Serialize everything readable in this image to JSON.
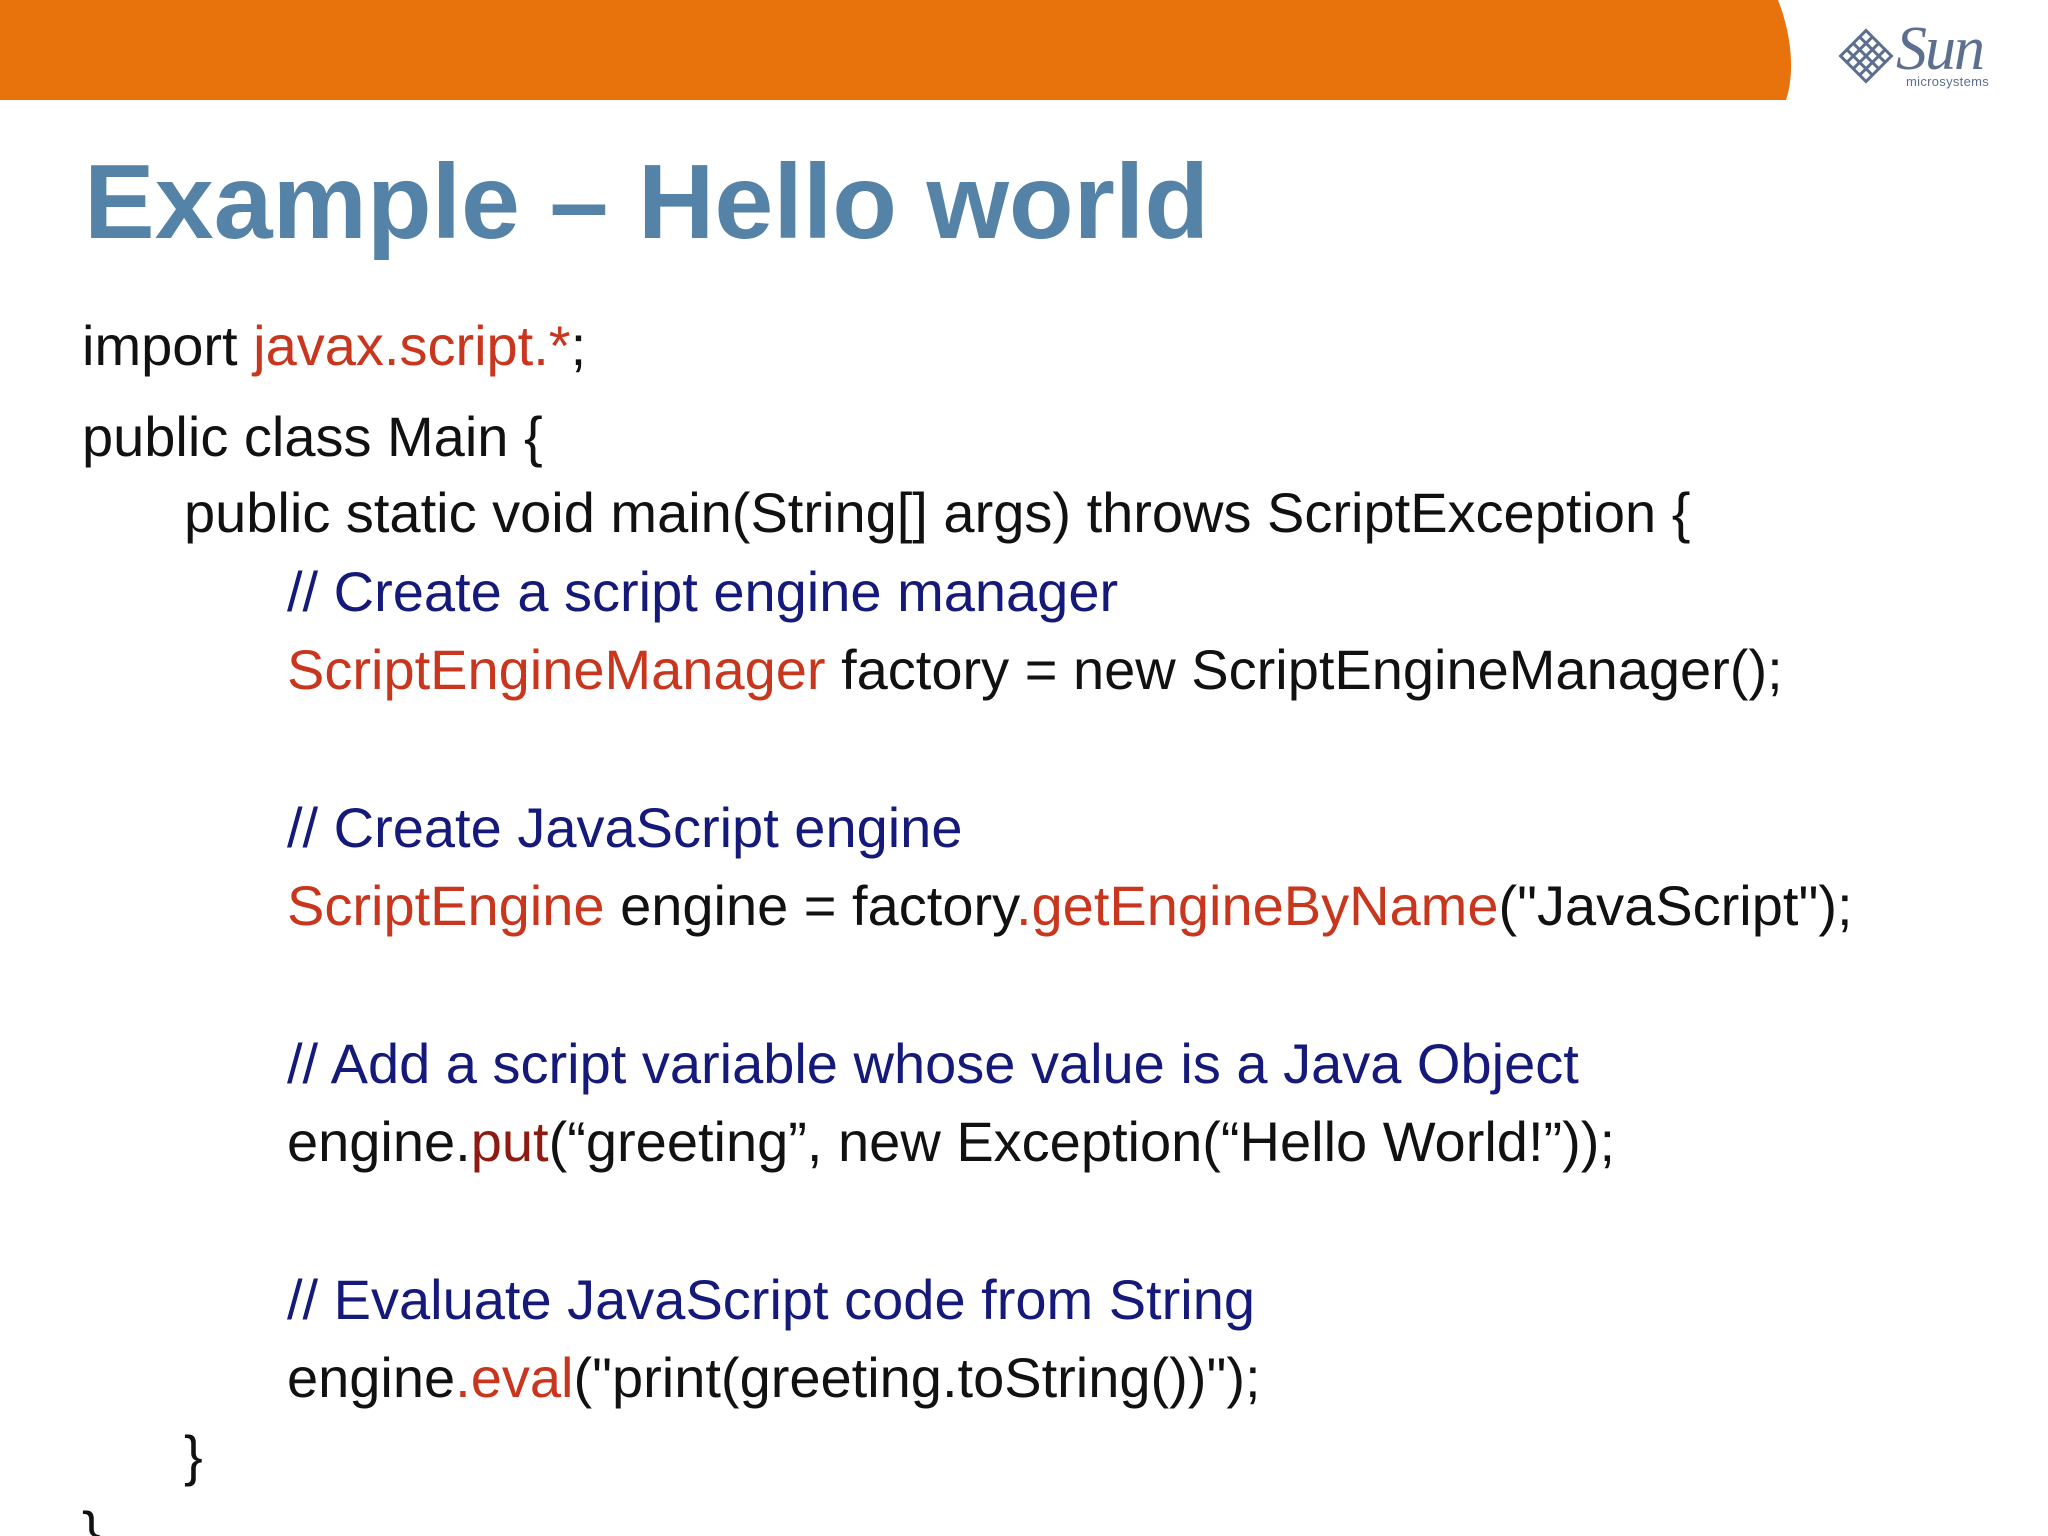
{
  "header": {
    "brand_name": "Sun",
    "brand_sub": "microsystems",
    "bar_color": "#e8720c",
    "logo_color": "#5c6f8e"
  },
  "slide": {
    "title": "Example – Hello world"
  },
  "code": {
    "line1": {
      "a": "import ",
      "b": "javax.script.",
      "c": "*",
      "d": ";"
    },
    "line2": {
      "a": "public class Main {"
    },
    "line3": {
      "a": "public static void main(String[] args) throws ScriptException {"
    },
    "line4": {
      "a": "// Create a script engine manager"
    },
    "line5": {
      "a": "ScriptEngineManager",
      "b": " factory = new ScriptEngineManager();"
    },
    "line6": {
      "a": "// Create JavaScript engine"
    },
    "line7": {
      "a": "ScriptEngine",
      "b": " engine = factory",
      "c": ".getEngineByName",
      "d": "(\"JavaScript\");"
    },
    "line8": {
      "a": "// Add a script variable whose value is a Java Object"
    },
    "line9": {
      "a": "engine.",
      "b": "put",
      "c": "(“greeting”, new Exception(“Hello World!”));"
    },
    "line10": {
      "a": "// Evaluate JavaScript code from String"
    },
    "line11": {
      "a": "engine",
      "b": ".eval",
      "c": "(\"print(greeting.toString())\");"
    },
    "line12": {
      "a": "}"
    },
    "line13": {
      "a": "}"
    }
  },
  "colors": {
    "title": "#5583a8",
    "keyword_red": "#c8361e",
    "method_dark_red": "#8e1a12",
    "comment_blue": "#14197a",
    "text": "#111111"
  }
}
